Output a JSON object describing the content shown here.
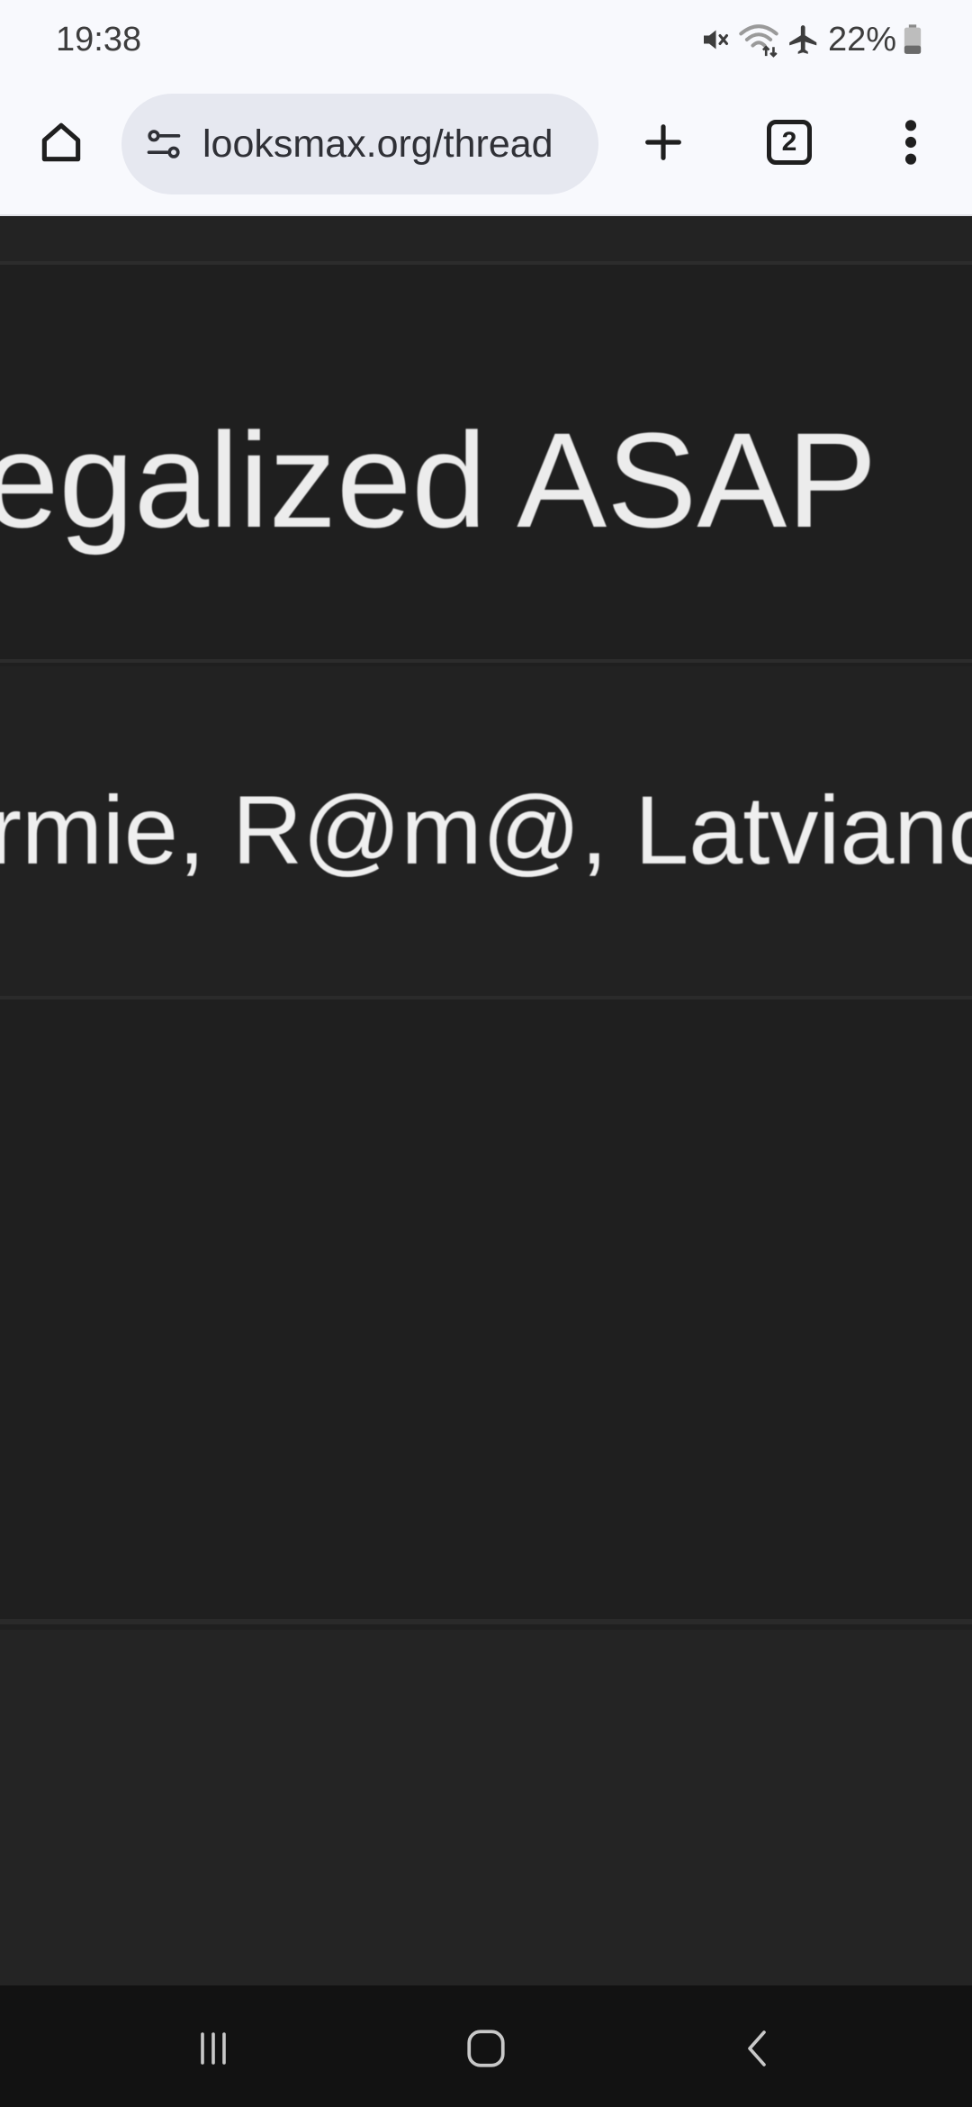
{
  "status_bar": {
    "time": "19:38",
    "battery": "22%",
    "icons": [
      "mute-icon",
      "wifi-icon",
      "airplane-mode-icon",
      "battery-icon"
    ]
  },
  "toolbar": {
    "url": "looksmax.org/thread",
    "tab_count": "2",
    "icons": [
      "home-icon",
      "site-settings-icon",
      "plus-icon",
      "tabs-icon",
      "more-vert-icon"
    ]
  },
  "page": {
    "title_fragment": "egalized ASAP",
    "viewers_fragment": "rmie, R@m@, Latvianc"
  },
  "nav_bar": {
    "icons": [
      "recents-icon",
      "home-circle-icon",
      "back-icon"
    ]
  }
}
